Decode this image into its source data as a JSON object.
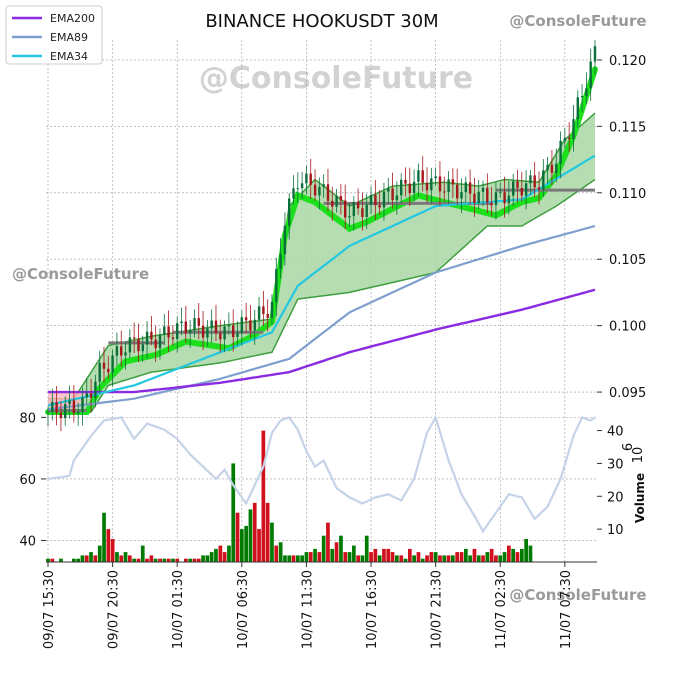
{
  "chart_data": {
    "type": "candlestick",
    "title": "BINANCE HOOKUSDT 30M",
    "watermarks": [
      "@ConsoleFuture",
      "@ConsoleFuture",
      "@ConsoleFuture",
      "@ConsoleFuture"
    ],
    "legend": {
      "placement": "top-left",
      "entries": [
        {
          "name": "EMA200",
          "color": "#8a2be2"
        },
        {
          "name": "EMA89",
          "color": "#7f9fcf"
        },
        {
          "name": "EMA34",
          "color": "#22c8e0"
        }
      ]
    },
    "x_tick_labels": [
      "09/07 15:30",
      "09/07 20:30",
      "10/07 01:30",
      "10/07 06:30",
      "10/07 11:30",
      "10/07 16:30",
      "10/07 21:30",
      "11/07 02:30",
      "11/07 07:30"
    ],
    "price_axis": {
      "ylim": [
        0.0935,
        0.1215
      ],
      "ticks": [
        "0.095",
        "0.100",
        "0.105",
        "0.110",
        "0.115",
        "0.120"
      ]
    },
    "left_axis": {
      "ylim": [
        33,
        85
      ],
      "ticks": [
        "40",
        "60",
        "80"
      ]
    },
    "volume_axis": {
      "label": "Volume",
      "multiplier": "10",
      "exponent": "6",
      "ylim": [
        0,
        42
      ],
      "ticks": [
        "10",
        "20",
        "30",
        "40"
      ]
    },
    "colors": {
      "up": "#007a00",
      "down": "#d0101c",
      "band_fill": "#a9d7a4",
      "band_line": "#3f9f3f",
      "band_core": "#1be01b",
      "level": "#7a7a7a",
      "osc": "#c5d3e8",
      "pink": "#ffb6c1"
    },
    "price_keypoints": [
      [
        0,
        0.0935
      ],
      [
        8,
        0.094
      ],
      [
        12,
        0.0965
      ],
      [
        18,
        0.0985
      ],
      [
        25,
        0.099
      ],
      [
        32,
        0.1
      ],
      [
        42,
        0.0995
      ],
      [
        48,
        0.1005
      ],
      [
        52,
        0.1015
      ],
      [
        55,
        0.108
      ],
      [
        58,
        0.111
      ],
      [
        62,
        0.1105
      ],
      [
        66,
        0.1095
      ],
      [
        70,
        0.1085
      ],
      [
        74,
        0.109
      ],
      [
        80,
        0.11
      ],
      [
        86,
        0.111
      ],
      [
        92,
        0.1105
      ],
      [
        98,
        0.11
      ],
      [
        104,
        0.1095
      ],
      [
        110,
        0.1105
      ],
      [
        114,
        0.1108
      ],
      [
        118,
        0.1125
      ],
      [
        122,
        0.1155
      ],
      [
        125,
        0.1185
      ],
      [
        127,
        0.1205
      ]
    ],
    "ema200_keypoints": [
      [
        0,
        0.095
      ],
      [
        20,
        0.095
      ],
      [
        40,
        0.0957
      ],
      [
        56,
        0.0965
      ],
      [
        70,
        0.098
      ],
      [
        90,
        0.0997
      ],
      [
        110,
        0.1012
      ],
      [
        127,
        0.1027
      ]
    ],
    "ema89_keypoints": [
      [
        0,
        0.0937
      ],
      [
        20,
        0.0945
      ],
      [
        40,
        0.096
      ],
      [
        56,
        0.0975
      ],
      [
        70,
        0.101
      ],
      [
        90,
        0.104
      ],
      [
        110,
        0.106
      ],
      [
        127,
        0.1075
      ]
    ],
    "ema34_keypoints": [
      [
        0,
        0.094
      ],
      [
        20,
        0.0955
      ],
      [
        40,
        0.098
      ],
      [
        52,
        0.0995
      ],
      [
        58,
        0.103
      ],
      [
        70,
        0.106
      ],
      [
        90,
        0.109
      ],
      [
        110,
        0.1095
      ],
      [
        127,
        0.1128
      ]
    ],
    "band_top_keypoints": [
      [
        0,
        0.0945
      ],
      [
        6,
        0.0945
      ],
      [
        14,
        0.0985
      ],
      [
        24,
        0.0992
      ],
      [
        40,
        0.1
      ],
      [
        52,
        0.1005
      ],
      [
        56,
        0.109
      ],
      [
        62,
        0.111
      ],
      [
        70,
        0.109
      ],
      [
        80,
        0.1105
      ],
      [
        92,
        0.1108
      ],
      [
        100,
        0.1105
      ],
      [
        106,
        0.111
      ],
      [
        114,
        0.1108
      ],
      [
        120,
        0.114
      ],
      [
        127,
        0.116
      ]
    ],
    "band_bottom_keypoints": [
      [
        0,
        0.0935
      ],
      [
        10,
        0.0935
      ],
      [
        14,
        0.0955
      ],
      [
        24,
        0.0965
      ],
      [
        40,
        0.0972
      ],
      [
        52,
        0.098
      ],
      [
        58,
        0.102
      ],
      [
        70,
        0.1025
      ],
      [
        90,
        0.104
      ],
      [
        102,
        0.1075
      ],
      [
        110,
        0.1075
      ],
      [
        118,
        0.109
      ],
      [
        127,
        0.111
      ]
    ],
    "level_segments": [
      [
        0,
        9,
        0.0936
      ],
      [
        14,
        27,
        0.0987
      ],
      [
        29,
        50,
        0.0995
      ],
      [
        64,
        103,
        0.1092
      ],
      [
        104,
        127,
        0.1102
      ]
    ],
    "volume_values": [
      1,
      1,
      0,
      1,
      0,
      0,
      1,
      1,
      2,
      2,
      3,
      2,
      5,
      15,
      10,
      7,
      3,
      2,
      3,
      2,
      1,
      1,
      5,
      1,
      2,
      1,
      1,
      1,
      1,
      1,
      1,
      0,
      1,
      1,
      1,
      1,
      2,
      2,
      3,
      4,
      5,
      3,
      5,
      30,
      15,
      10,
      11,
      16,
      18,
      10,
      40,
      18,
      12,
      5,
      6,
      2,
      2,
      2,
      2,
      2,
      3,
      3,
      4,
      3,
      8,
      12,
      4,
      6,
      8,
      3,
      3,
      5,
      2,
      2,
      8,
      3,
      4,
      2,
      4,
      4,
      3,
      2,
      2,
      1,
      4,
      2,
      3,
      1,
      2,
      3,
      3,
      2,
      2,
      2,
      2,
      3,
      3,
      4,
      2,
      4,
      2,
      2,
      3,
      4,
      2,
      2,
      3,
      5,
      4,
      3,
      4,
      7,
      5
    ],
    "volume_up": [
      true,
      false,
      true,
      true,
      false,
      true,
      true,
      true,
      true,
      false,
      true,
      false,
      true,
      true,
      false,
      false,
      true,
      false,
      true,
      false,
      true,
      false,
      true,
      false,
      false,
      true,
      false,
      true,
      false,
      true,
      false,
      true,
      false,
      true,
      false,
      false,
      true,
      true,
      true,
      true,
      false,
      false,
      true,
      true,
      false,
      true,
      true,
      true,
      false,
      false,
      false,
      false,
      true,
      false,
      true,
      true,
      true,
      false,
      true,
      true,
      true,
      false,
      true,
      false,
      true,
      false,
      true,
      false,
      true,
      false,
      true,
      true,
      false,
      true,
      true,
      false,
      false,
      true,
      false,
      false,
      false,
      true,
      false,
      true,
      false,
      true,
      false,
      true,
      false,
      false,
      true,
      false,
      true,
      false,
      true,
      false,
      false,
      true,
      true,
      false,
      true,
      false,
      true,
      false,
      false,
      true,
      true,
      false,
      true,
      false,
      true,
      true,
      true
    ],
    "osc_keypoints": [
      [
        0,
        60
      ],
      [
        5,
        61
      ],
      [
        6,
        66
      ],
      [
        8,
        70
      ],
      [
        10,
        74
      ],
      [
        13,
        79
      ],
      [
        17,
        80
      ],
      [
        20,
        73
      ],
      [
        23,
        78
      ],
      [
        27,
        76
      ],
      [
        30,
        73
      ],
      [
        33,
        68
      ],
      [
        36,
        64
      ],
      [
        39,
        60
      ],
      [
        41,
        63
      ],
      [
        43,
        58
      ],
      [
        46,
        52
      ],
      [
        48,
        58
      ],
      [
        50,
        64
      ],
      [
        52,
        75
      ],
      [
        54,
        79
      ],
      [
        56,
        80
      ],
      [
        58,
        76
      ],
      [
        60,
        69
      ],
      [
        62,
        64
      ],
      [
        64,
        66
      ],
      [
        67,
        57
      ],
      [
        70,
        54
      ],
      [
        73,
        52
      ],
      [
        76,
        54
      ],
      [
        79,
        55
      ],
      [
        82,
        53
      ],
      [
        85,
        60
      ],
      [
        88,
        75
      ],
      [
        90,
        80
      ],
      [
        93,
        66
      ],
      [
        96,
        55
      ],
      [
        99,
        48
      ],
      [
        101,
        43
      ],
      [
        104,
        49
      ],
      [
        107,
        55
      ],
      [
        110,
        54
      ],
      [
        113,
        47
      ],
      [
        116,
        51
      ],
      [
        119,
        60
      ],
      [
        122,
        74
      ],
      [
        124,
        80
      ],
      [
        126,
        79
      ],
      [
        127,
        80
      ]
    ]
  }
}
